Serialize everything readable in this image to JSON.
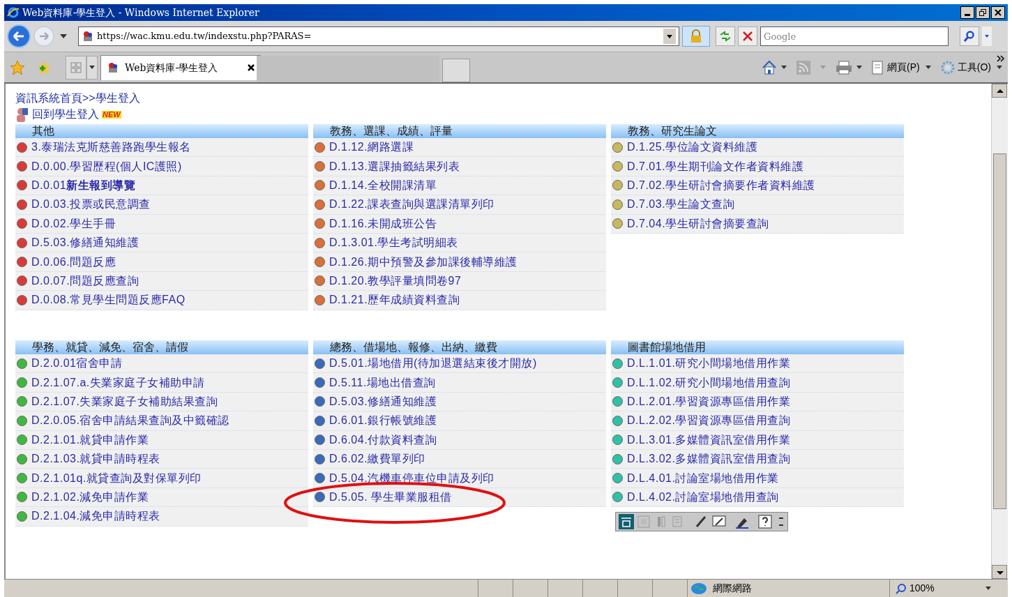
{
  "window": {
    "title": "Web資料庫-學生登入 - Windows Internet Explorer"
  },
  "address_bar": {
    "url": "https://wac.kmu.edu.tw/indexstu.php?PARAS="
  },
  "search": {
    "placeholder": "Google"
  },
  "tabs": [
    {
      "label": "Web資料庫-學生登入",
      "selected": true
    }
  ],
  "command_bar": [
    {
      "label": "網頁(P)"
    },
    {
      "label": "工具(O)"
    }
  ],
  "breadcrumb": "資訊系統首頁>>學生登入",
  "back_link": {
    "label": "回到學生登入",
    "badge": "NEW"
  },
  "panels": [
    {
      "title": "其他",
      "color": "#d83a3a",
      "items": [
        "3.泰瑞法克斯慈善路跑學生報名",
        "D.0.00.學習歷程(個人IC護照)",
        "D.0.01**新生報到導覽**",
        "D.0.03.投票或民意調查",
        "D.0.02.學生手冊",
        "D.5.03.修繕通知維護",
        "D.0.06.問題反應",
        "D.0.07.問題反應查詢",
        "D.0.08.常見學生問題反應FAQ"
      ]
    },
    {
      "title": "教務、選課、成績、評量",
      "color": "#d8703a",
      "items": [
        "D.1.12.網路選課",
        "D.1.13.選課抽籤結果列表",
        "D.1.14.全校開課清單",
        "D.1.22.課表查詢與選課清單列印",
        "D.1.16.未開成班公告",
        "D.1.3.01.學生考試明細表",
        "D.1.26.期中預警及參加課後輔導維護",
        "D.1.20.教學評量填問卷97",
        "D.1.21.歷年成績資料查詢"
      ]
    },
    {
      "title": "教務、研究生論文",
      "color": "#c8b860",
      "items": [
        "D.1.25.學位論文資料維護",
        "D.7.01.學生期刊論文作者資料維護",
        "D.7.02.學生研討會摘要作者資料維護",
        "D.7.03.學生論文查詢",
        "D.7.04.學生研討會摘要查詢"
      ]
    },
    {
      "title": "學務、就貸、減免、宿舍、請假",
      "color": "#40b840",
      "items": [
        "D.2.0.01宿舍申請",
        "D.2.1.07.a.失業家庭子女補助申請",
        "D.2.1.07.失業家庭子女補助結果查詢",
        "D.2.0.05.宿舍申請結果查詢及中籤確認",
        "D.2.1.01.就貸申請作業",
        "D.2.1.03.就貸申請時程表",
        "D.2.1.01q.就貸查詢及對保單列印",
        "D.2.1.02.減免申請作業",
        "D.2.1.04.減免申請時程表"
      ]
    },
    {
      "title": "總務、借場地、報修、出納、繳費",
      "color": "#3a6ab8",
      "items": [
        "D.5.01.場地借用(待加退選結束後才開放)",
        "D.5.11.場地出借查詢",
        "D.5.03.修繕通知維護",
        "D.6.01.銀行帳號維護",
        "D.6.04.付款資料查詢",
        "D.6.02.繳費單列印",
        "D.5.04.汽機車停車位申請及列印",
        "D.5.05. 學生畢業服租借"
      ]
    },
    {
      "title": "圖書館場地借用",
      "color": "#30c0a8",
      "items": [
        "D.L.1.01.研究小間場地借用作業",
        "D.L.1.02.研究小間場地借用查詢",
        "D.L.2.01.學習資源專區借用作業",
        "D.L.2.02.學習資源專區借用查詢",
        "D.L.3.01.多媒體資訊室借用作業",
        "D.L.3.02.多媒體資訊室借用查詢",
        "D.L.4.01.討論室場地借用作業",
        "D.L.4.02.討論室場地借用查詢"
      ]
    }
  ],
  "status_bar": {
    "zone": "網際網路",
    "zoom": "100%"
  }
}
